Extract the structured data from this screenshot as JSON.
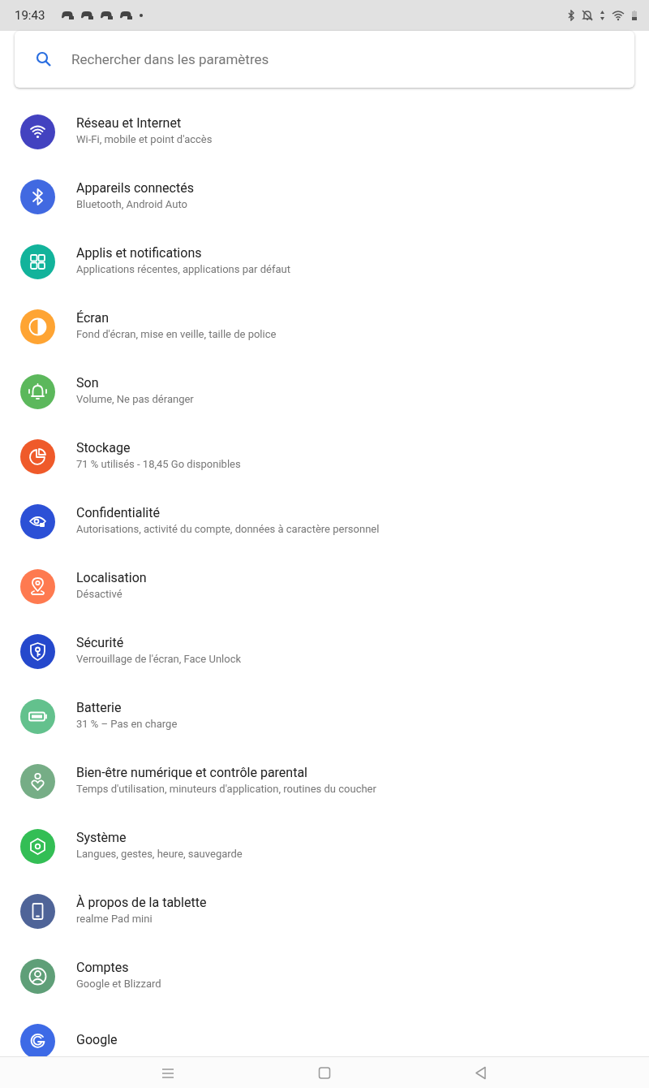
{
  "status_bar": {
    "time": "19:43"
  },
  "search": {
    "placeholder": "Rechercher dans les paramètres"
  },
  "items": [
    {
      "title": "Réseau et Internet",
      "subtitle": "Wi-Fi, mobile et point d'accès",
      "kind": "wifi",
      "color": "#4342c0"
    },
    {
      "title": "Appareils connectés",
      "subtitle": "Bluetooth, Android Auto",
      "kind": "bluetooth",
      "color": "#4169e1"
    },
    {
      "title": "Applis et notifications",
      "subtitle": "Applications récentes, applications par défaut",
      "kind": "apps",
      "color": "#12b39b"
    },
    {
      "title": "Écran",
      "subtitle": "Fond d'écran, mise en veille, taille de police",
      "kind": "display",
      "color": "#fea433"
    },
    {
      "title": "Son",
      "subtitle": "Volume, Ne pas déranger",
      "kind": "bell",
      "color": "#5cb85c"
    },
    {
      "title": "Stockage",
      "subtitle": "71 % utilisés - 18,45 Go disponibles",
      "kind": "pie",
      "color": "#ef5a2a"
    },
    {
      "title": "Confidentialité",
      "subtitle": "Autorisations, activité du compte, données à caractère personnel",
      "kind": "eye",
      "color": "#2c50d6"
    },
    {
      "title": "Localisation",
      "subtitle": "Désactivé",
      "kind": "pin",
      "color": "#fe7a50"
    },
    {
      "title": "Sécurité",
      "subtitle": "Verrouillage de l'écran, Face Unlock",
      "kind": "shield",
      "color": "#2548cc"
    },
    {
      "title": "Batterie",
      "subtitle": "31 % – Pas en charge",
      "kind": "battery",
      "color": "#63c18d"
    },
    {
      "title": "Bien-être numérique et contrôle parental",
      "subtitle": "Temps d'utilisation, minuteurs d'application, routines du coucher",
      "kind": "wellbeing",
      "color": "#76ad86"
    },
    {
      "title": "Système",
      "subtitle": "Langues, gestes, heure, sauvegarde",
      "kind": "system",
      "color": "#33be55"
    },
    {
      "title": "À propos de la tablette",
      "subtitle": "realme Pad mini",
      "kind": "tablet",
      "color": "#4f6498"
    },
    {
      "title": "Comptes",
      "subtitle": "Google et Blizzard",
      "kind": "account",
      "color": "#5f9f78"
    },
    {
      "title": "Google",
      "kind": "google",
      "color": "#3d6ae6"
    }
  ]
}
